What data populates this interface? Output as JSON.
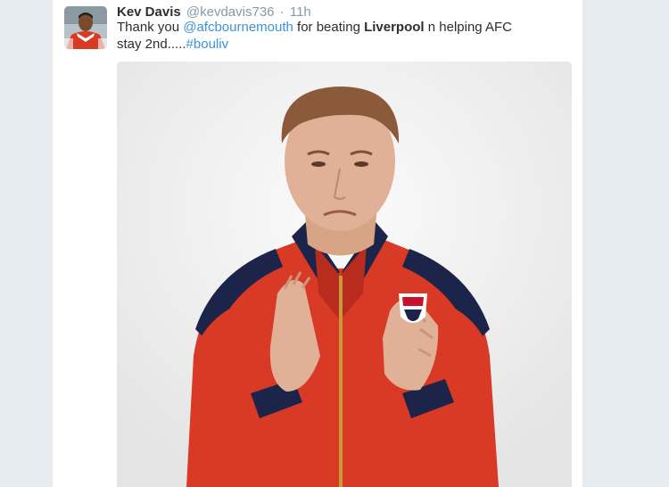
{
  "tweet": {
    "author_name": "Kev Davis",
    "author_handle": "@kevdavis736",
    "separator": "·",
    "time": "11h",
    "text": {
      "t1": "Thank you ",
      "mention": "@afcbournemouth",
      "t2": " for beating ",
      "bold": "Liverpool",
      "t3": " n helping AFC stay 2nd.....",
      "hashtag": "#bouliv"
    },
    "media_subject": "animated-gif-player-clapping"
  },
  "colors": {
    "background": "#e6ecf0",
    "card": "#ffffff",
    "name": "#292f33",
    "meta": "#8899a6",
    "link": "#3b94d9",
    "jacket_red": "#d83a26",
    "jacket_navy": "#1c2549"
  },
  "icons": {
    "avatar": "avatar-image",
    "crest": "club-crest-icon"
  }
}
